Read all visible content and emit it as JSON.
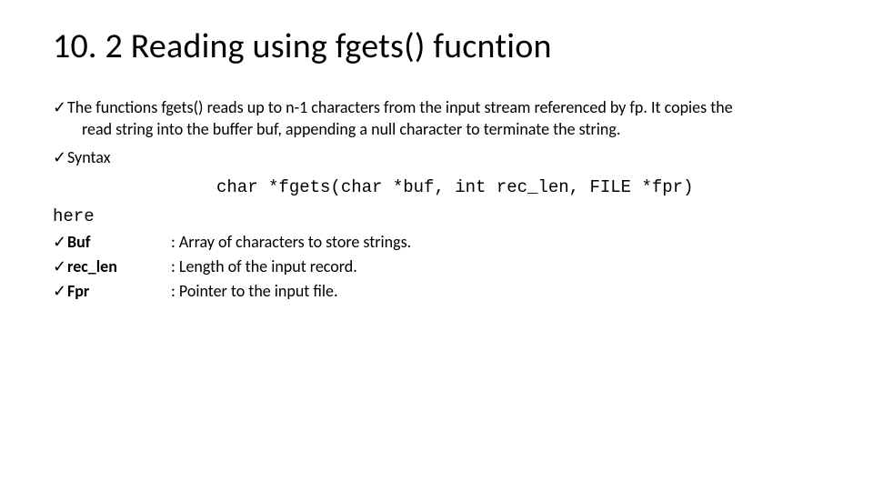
{
  "title": "10. 2 Reading using fgets() fucntion",
  "bullets": {
    "desc_line1": "The functions fgets() reads up to n-1 characters from the input stream referenced by fp. It copies the",
    "desc_line2": "read string into the buffer buf, appending a null character to terminate the string.",
    "syntax_label": "Syntax"
  },
  "code": "char *fgets(char *buf, int rec_len, FILE *fpr)",
  "here_label": "here",
  "params": [
    {
      "term": "Buf",
      "desc": ": Array of characters to store strings."
    },
    {
      "term": "rec_len",
      "desc": ": Length of the input record."
    },
    {
      "term": "Fpr",
      "desc": ": Pointer to the input file."
    }
  ],
  "check_glyph": "✓"
}
